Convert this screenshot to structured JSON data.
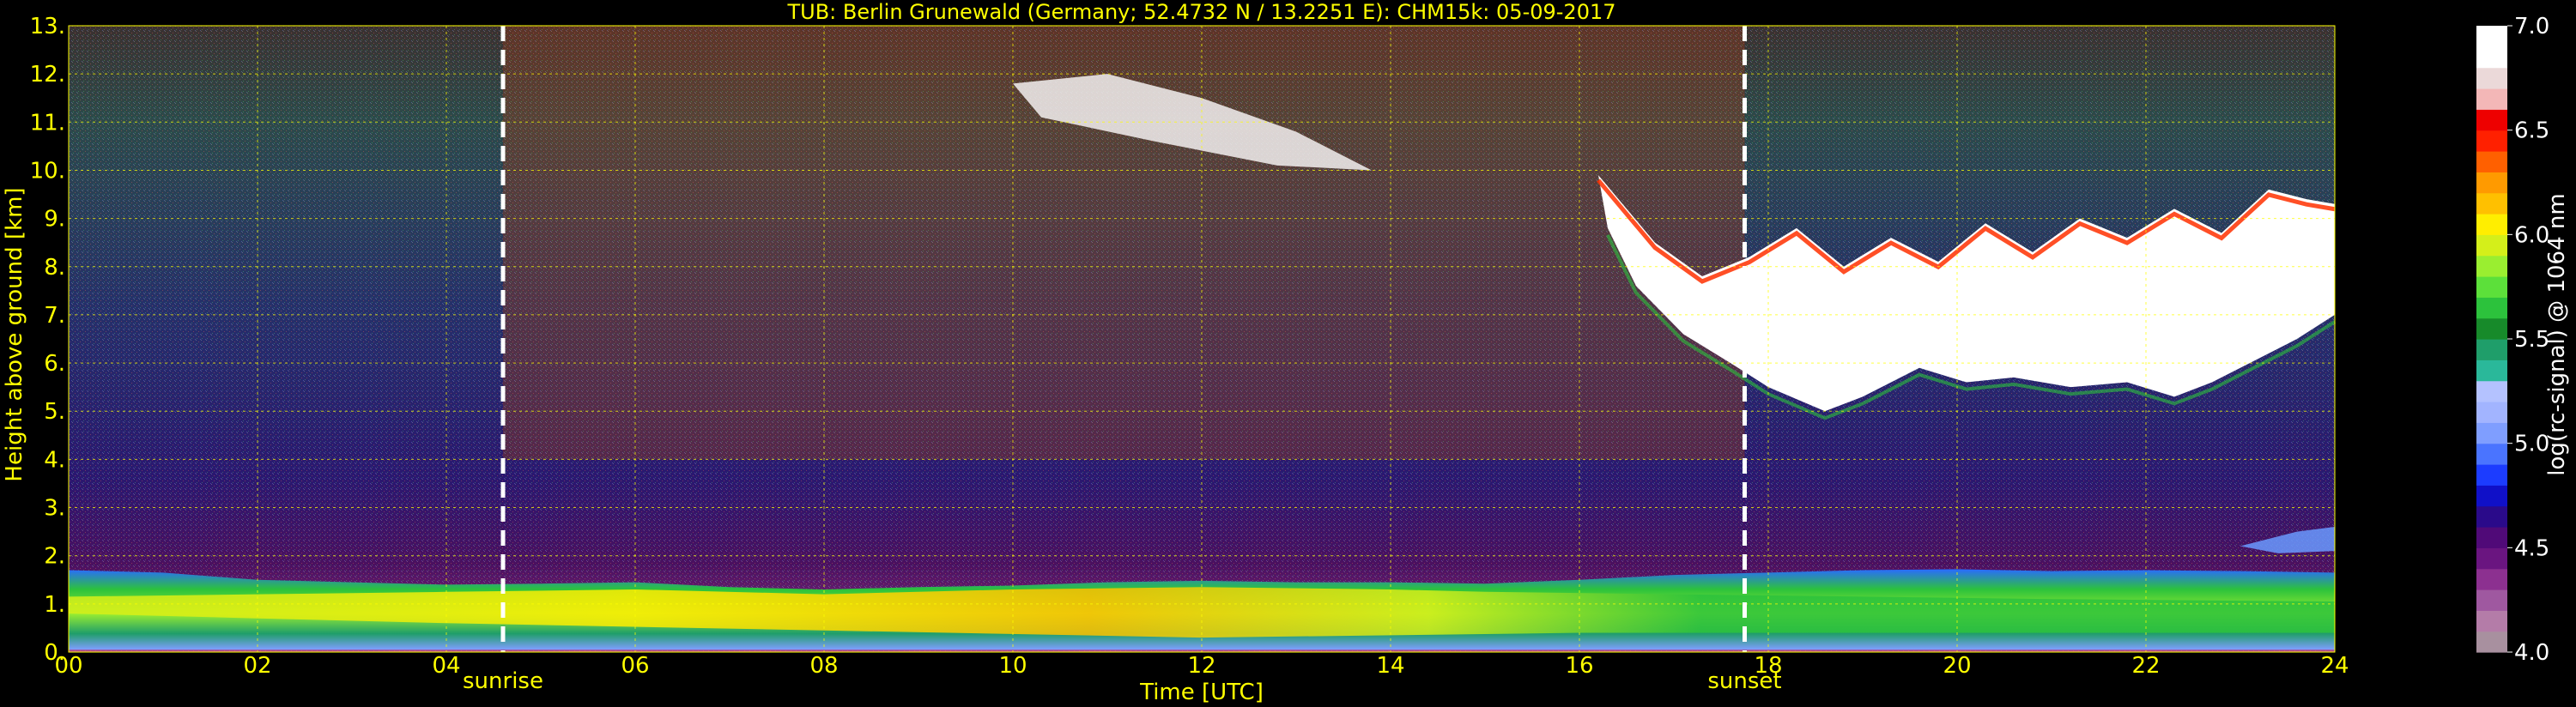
{
  "chart_data": {
    "type": "heatmap",
    "title": "TUB: Berlin Grunewald (Germany; 52.4732 N / 13.2251 E):    CHM15k: 05-09-2017",
    "xlabel": "Time [UTC]",
    "ylabel": "Height above ground [km]",
    "xlim": [
      0,
      24
    ],
    "ylim": [
      0,
      13
    ],
    "x_ticks": [
      "00",
      "02",
      "04",
      "06",
      "08",
      "10",
      "12",
      "14",
      "16",
      "18",
      "20",
      "22",
      "24"
    ],
    "y_ticks": [
      "0.",
      "1.",
      "2.",
      "3.",
      "4.",
      "5.",
      "6.",
      "7.",
      "8.",
      "9.",
      "10.",
      "11.",
      "12.",
      "13."
    ],
    "grid": true,
    "markers": [
      {
        "label": "sunrise",
        "x": 4.6
      },
      {
        "label": "sunset",
        "x": 17.75
      }
    ],
    "colorbar": {
      "label": "log(rc-signal) @ 1064 nm",
      "range": [
        4.0,
        7.0
      ],
      "ticks": [
        "4.0",
        "4.5",
        "5.0",
        "5.5",
        "6.0",
        "6.5",
        "7.0"
      ],
      "colors": [
        "#a8909f",
        "#b47ca8",
        "#9f58a0",
        "#8c3090",
        "#6a1580",
        "#500a78",
        "#2a0a8a",
        "#1010c8",
        "#1c3cff",
        "#4a74ff",
        "#7f9eff",
        "#a2b4ff",
        "#b4c2ff",
        "#2ab89a",
        "#1f9e6a",
        "#178a2a",
        "#2cc23c",
        "#5ce03a",
        "#9aee30",
        "#d4ef1a",
        "#ffee00",
        "#ffc000",
        "#ff9a00",
        "#ff6000",
        "#ff2000",
        "#ee0000",
        "#f3b7b7",
        "#ebd9d9",
        "#ffffff",
        "#ffffff"
      ]
    }
  }
}
